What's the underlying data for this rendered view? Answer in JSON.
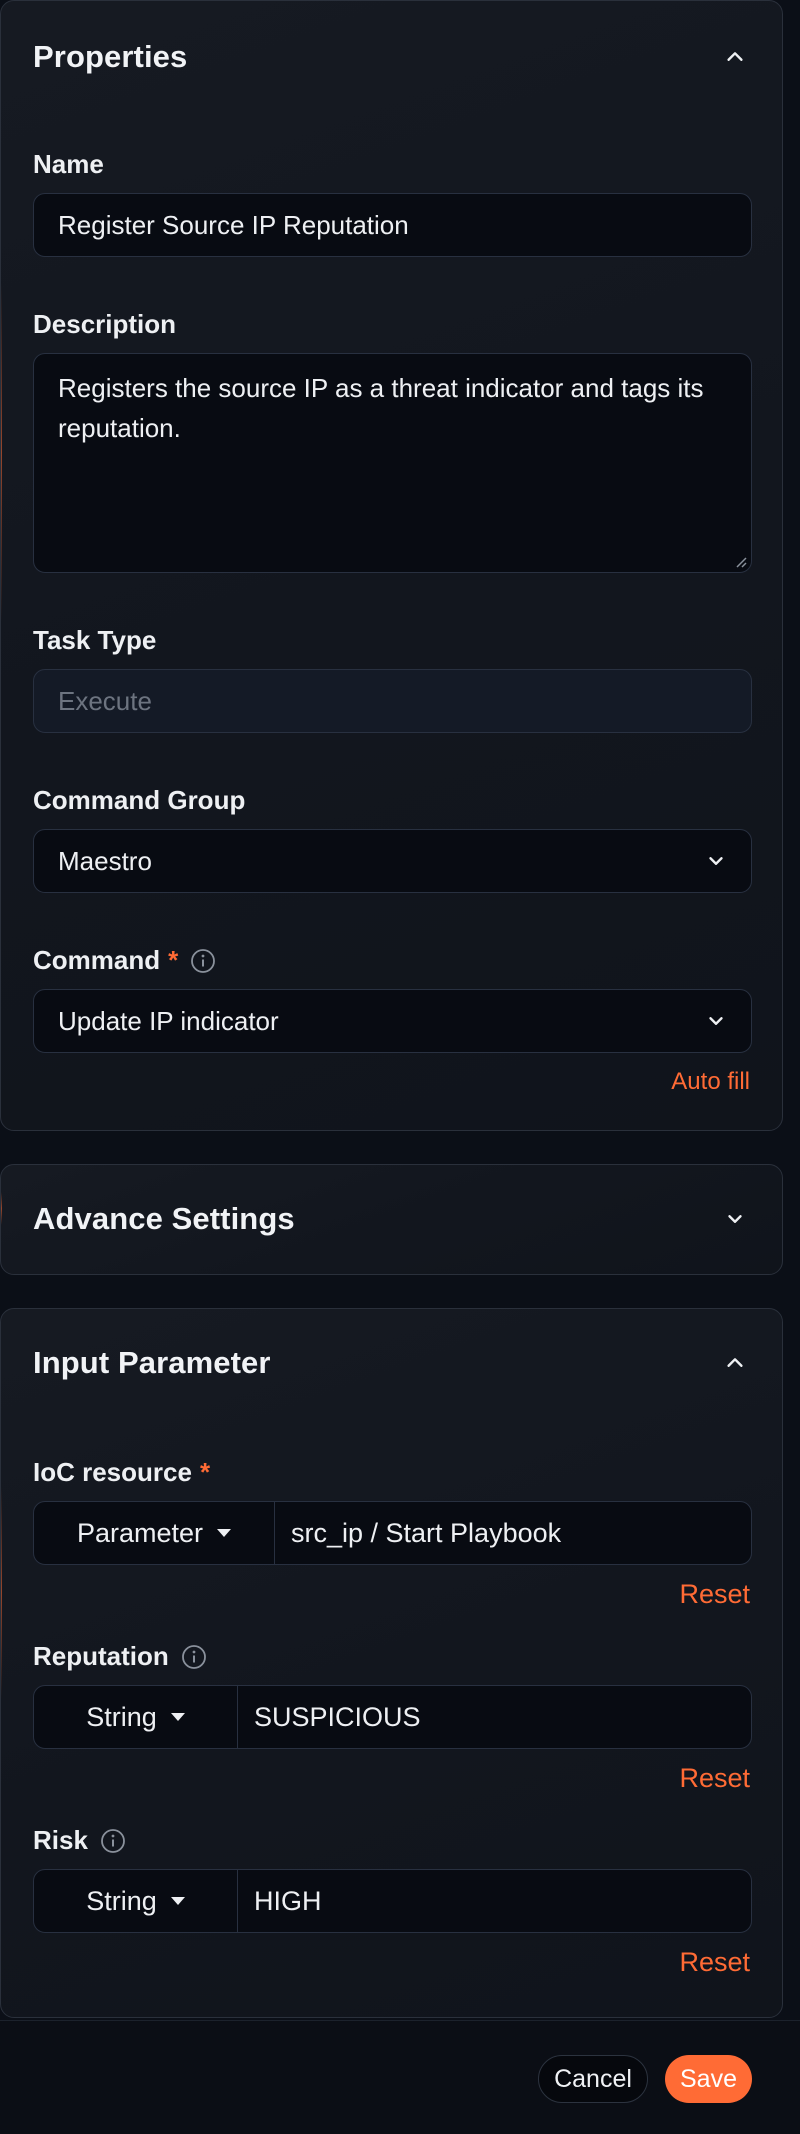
{
  "colors": {
    "accent": "#ff6b35",
    "background": "#0b0f17",
    "input_bg": "#080b12"
  },
  "properties": {
    "title": "Properties",
    "toggle_icon": "chevron-up-icon",
    "name": {
      "label": "Name",
      "value": "Register Source IP Reputation"
    },
    "description": {
      "label": "Description",
      "value": "Registers the source IP as a threat indicator and tags its reputation."
    },
    "task_type": {
      "label": "Task Type",
      "placeholder": "Execute"
    },
    "command_group": {
      "label": "Command Group",
      "value": "Maestro"
    },
    "command": {
      "label": "Command",
      "required_mark": "*",
      "value": "Update IP indicator"
    },
    "auto_fill": "Auto fill"
  },
  "advance_settings": {
    "title": "Advance Settings",
    "toggle_icon": "chevron-down-icon"
  },
  "input_parameter": {
    "title": "Input Parameter",
    "toggle_icon": "chevron-up-icon",
    "params": [
      {
        "label": "IoC resource",
        "required_mark": "*",
        "type": "Parameter",
        "value": "src_ip / Start Playbook",
        "reset": "Reset"
      },
      {
        "label": "Reputation",
        "type": "String",
        "value": "SUSPICIOUS",
        "reset": "Reset"
      },
      {
        "label": "Risk",
        "type": "String",
        "value": "HIGH",
        "reset": "Reset"
      }
    ]
  },
  "footer": {
    "cancel": "Cancel",
    "save": "Save"
  }
}
